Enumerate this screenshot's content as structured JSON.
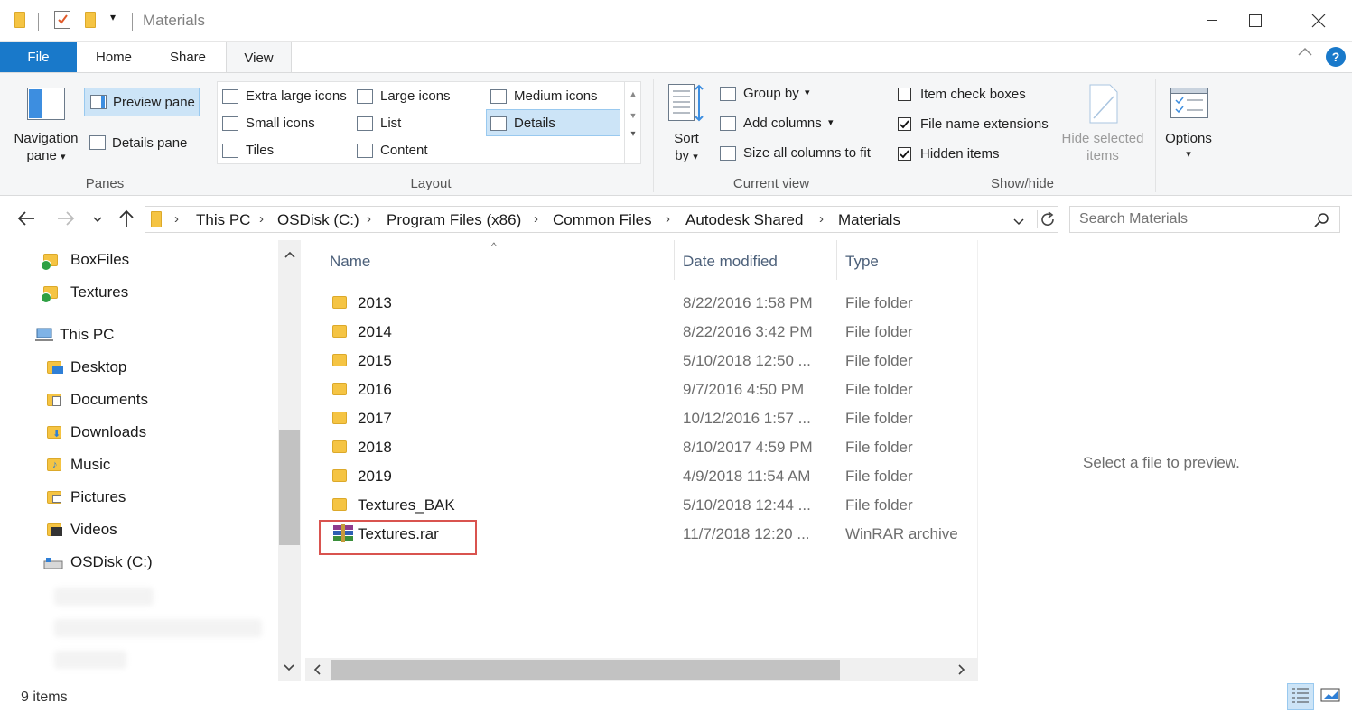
{
  "window": {
    "title": "Materials",
    "minimize_icon": "minimize-icon",
    "maximize_icon": "maximize-icon",
    "close_icon": "close-icon"
  },
  "tabs": [
    {
      "label": "File"
    },
    {
      "label": "Home"
    },
    {
      "label": "Share"
    },
    {
      "label": "View"
    }
  ],
  "ribbon": {
    "panes": {
      "navigation_pane": "Navigation",
      "navigation_pane_line2": "pane",
      "preview_pane": "Preview pane",
      "details_pane": "Details pane",
      "group_label": "Panes"
    },
    "layout": {
      "items": [
        "Extra large icons",
        "Large icons",
        "Medium icons",
        "Small icons",
        "List",
        "Details",
        "Tiles",
        "Content"
      ],
      "selected": "Details",
      "group_label": "Layout"
    },
    "current_view": {
      "sort_by": "Sort",
      "sort_by_line2": "by",
      "group_by": "Group by",
      "add_columns": "Add columns",
      "size_all": "Size all columns to fit",
      "group_label": "Current view"
    },
    "show_hide": {
      "item_check_boxes": "Item check boxes",
      "item_check_boxes_checked": false,
      "file_name_extensions": "File name extensions",
      "file_name_extensions_checked": true,
      "hidden_items": "Hidden items",
      "hidden_items_checked": true,
      "hide_selected": "Hide selected",
      "hide_selected_line2": "items",
      "group_label": "Show/hide"
    },
    "options": {
      "label": "Options"
    }
  },
  "address": {
    "crumbs": [
      "This PC",
      "OSDisk (C:)",
      "Program Files (x86)",
      "Common Files",
      "Autodesk Shared",
      "Materials"
    ]
  },
  "search": {
    "placeholder": "Search Materials"
  },
  "nav": {
    "items": [
      {
        "label": "BoxFiles",
        "icon": "synced-folder-icon"
      },
      {
        "label": "Textures",
        "icon": "synced-folder-icon"
      },
      {
        "label": "This PC",
        "icon": "computer-icon"
      },
      {
        "label": "Desktop",
        "icon": "desktop-folder-icon"
      },
      {
        "label": "Documents",
        "icon": "documents-folder-icon"
      },
      {
        "label": "Downloads",
        "icon": "downloads-folder-icon"
      },
      {
        "label": "Music",
        "icon": "music-folder-icon"
      },
      {
        "label": "Pictures",
        "icon": "pictures-folder-icon"
      },
      {
        "label": "Videos",
        "icon": "videos-folder-icon"
      },
      {
        "label": "OSDisk (C:)",
        "icon": "drive-icon"
      }
    ]
  },
  "filelist": {
    "columns": {
      "name": "Name",
      "date": "Date modified",
      "type": "Type"
    },
    "rows": [
      {
        "name": "2013",
        "date": "8/22/2016 1:58 PM",
        "type": "File folder"
      },
      {
        "name": "2014",
        "date": "8/22/2016 3:42 PM",
        "type": "File folder"
      },
      {
        "name": "2015",
        "date": "5/10/2018 12:50 ...",
        "type": "File folder"
      },
      {
        "name": "2016",
        "date": "9/7/2016 4:50 PM",
        "type": "File folder"
      },
      {
        "name": "2017",
        "date": "10/12/2016 1:57 ...",
        "type": "File folder"
      },
      {
        "name": "2018",
        "date": "8/10/2017 4:59 PM",
        "type": "File folder"
      },
      {
        "name": "2019",
        "date": "4/9/2018 11:54 AM",
        "type": "File folder"
      },
      {
        "name": "Textures_BAK",
        "date": "5/10/2018 12:44 ...",
        "type": "File folder"
      },
      {
        "name": "Textures.rar",
        "date": "11/7/2018 12:20 ...",
        "type": "WinRAR archive"
      }
    ]
  },
  "preview": {
    "message": "Select a file to preview."
  },
  "status": {
    "count": "9 items"
  }
}
